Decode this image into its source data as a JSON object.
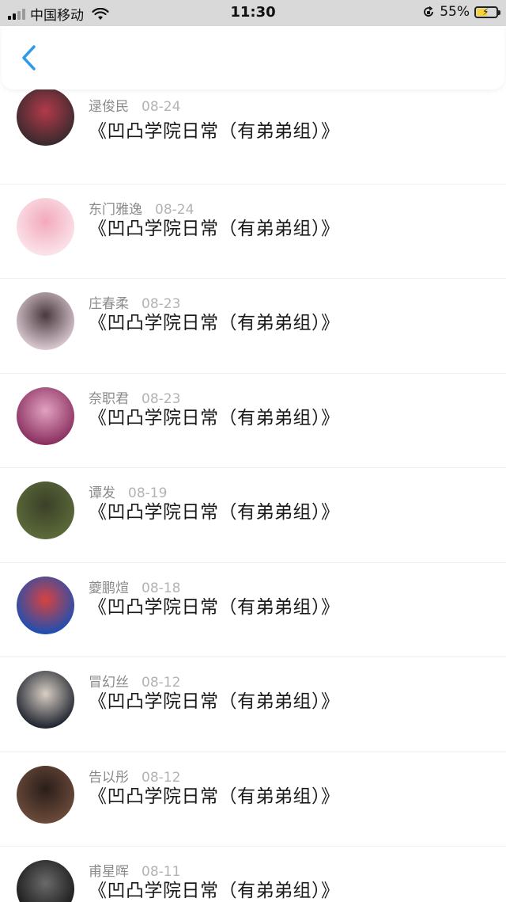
{
  "status_bar": {
    "carrier": "中国移动",
    "time": "11:30",
    "battery": "55%",
    "battery_level": 0.55
  },
  "header": {
    "back_icon": "chevron-left-icon",
    "accent": "#2f9be8"
  },
  "items": [
    {
      "name": "逯俊民",
      "date": "08-24",
      "title": "《凹凸学院日常（有弟弟组）》",
      "avatar_colors": [
        "#3a2a2e",
        "#b23a4a"
      ]
    },
    {
      "name": "东门雅逸",
      "date": "08-24",
      "title": "《凹凸学院日常（有弟弟组）》",
      "avatar_colors": [
        "#fbe3ea",
        "#f2a9bb"
      ]
    },
    {
      "name": "庄春柔",
      "date": "08-23",
      "title": "《凹凸学院日常（有弟弟组）》",
      "avatar_colors": [
        "#d9c7cf",
        "#4a3a3f"
      ]
    },
    {
      "name": "奈职君",
      "date": "08-23",
      "title": "《凹凸学院日常（有弟弟组）》",
      "avatar_colors": [
        "#8a3060",
        "#e2a2c0"
      ]
    },
    {
      "name": "谭发",
      "date": "08-19",
      "title": "《凹凸学院日常（有弟弟组）》",
      "avatar_colors": [
        "#5b6a3a",
        "#3b4028"
      ]
    },
    {
      "name": "夔鹏煊",
      "date": "08-18",
      "title": "《凹凸学院日常（有弟弟组）》",
      "avatar_colors": [
        "#1f4fb0",
        "#d8423f"
      ]
    },
    {
      "name": "冒幻丝",
      "date": "08-12",
      "title": "《凹凸学院日常（有弟弟组）》",
      "avatar_colors": [
        "#202530",
        "#d9cfc4"
      ]
    },
    {
      "name": "告以彤",
      "date": "08-12",
      "title": "《凹凸学院日常（有弟弟组）》",
      "avatar_colors": [
        "#6b4a3a",
        "#2a1e1a"
      ]
    },
    {
      "name": "甫星晖",
      "date": "08-11",
      "title": "《凹凸学院日常（有弟弟组）》",
      "avatar_colors": [
        "#1a1a1a",
        "#6a6a6a"
      ]
    }
  ]
}
